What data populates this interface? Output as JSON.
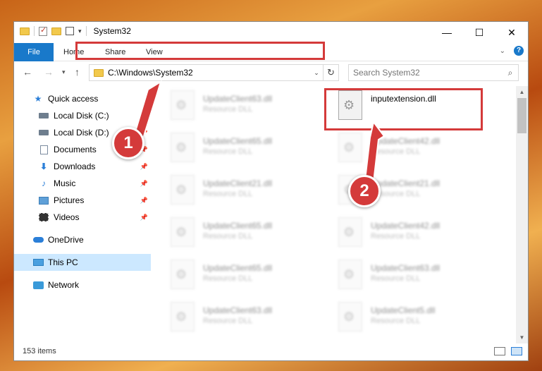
{
  "window": {
    "title": "System32",
    "controls": {
      "minimize": "—",
      "maximize": "☐",
      "close": "✕"
    }
  },
  "ribbon": {
    "tabs": [
      "File",
      "Home",
      "Share",
      "View"
    ]
  },
  "nav": {
    "address": "C:\\Windows\\System32",
    "search_placeholder": "Search System32"
  },
  "sidebar": {
    "items": [
      {
        "label": "Quick access",
        "icon": "star-icon",
        "pinned": false
      },
      {
        "label": "Local Disk (C:)",
        "icon": "disk-icon",
        "pinned": true
      },
      {
        "label": "Local Disk (D:)",
        "icon": "disk-icon",
        "pinned": true
      },
      {
        "label": "Documents",
        "icon": "document-icon",
        "pinned": true
      },
      {
        "label": "Downloads",
        "icon": "download-icon",
        "pinned": true
      },
      {
        "label": "Music",
        "icon": "music-icon",
        "pinned": true
      },
      {
        "label": "Pictures",
        "icon": "pictures-icon",
        "pinned": true
      },
      {
        "label": "Videos",
        "icon": "videos-icon",
        "pinned": true
      },
      {
        "label": "OneDrive",
        "icon": "onedrive-icon",
        "pinned": false
      },
      {
        "label": "This PC",
        "icon": "this-pc-icon",
        "pinned": false,
        "selected": true
      },
      {
        "label": "Network",
        "icon": "network-icon",
        "pinned": false
      }
    ]
  },
  "files": {
    "left": [
      {
        "name": "UpdateClient63.dll",
        "type": "Resource DLL"
      },
      {
        "name": "UpdateClient65.dll",
        "type": "Resource DLL"
      },
      {
        "name": "UpdateClient21.dll",
        "type": "Resource DLL"
      },
      {
        "name": "UpdateClient65.dll",
        "type": "Resource DLL"
      },
      {
        "name": "UpdateClient65.dll",
        "type": "Resource DLL"
      },
      {
        "name": "UpdateClient63.dll",
        "type": "Resource DLL"
      }
    ],
    "right": [
      {
        "name": "inputextension.dll",
        "type": "",
        "highlighted": true
      },
      {
        "name": "UpdateClient42.dll",
        "type": "Resource DLL"
      },
      {
        "name": "UpdateClient21.dll",
        "type": "Resource DLL"
      },
      {
        "name": "UpdateClient42.dll",
        "type": "Resource DLL"
      },
      {
        "name": "UpdateClient63.dll",
        "type": "Resource DLL"
      },
      {
        "name": "UpdateClient5.dll",
        "type": "Resource DLL"
      }
    ]
  },
  "status": {
    "item_count": "153 items"
  },
  "annotations": {
    "badge1": "1",
    "badge2": "2",
    "highlight_color": "#d43a3a"
  },
  "colors": {
    "accent": "#1979ca",
    "selected_bg": "#cce8ff"
  }
}
